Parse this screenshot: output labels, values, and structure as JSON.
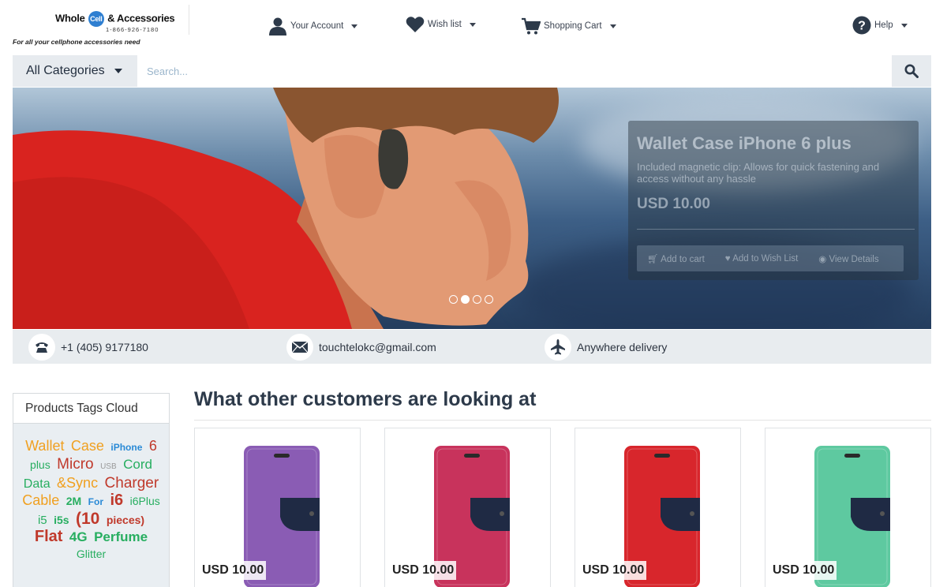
{
  "logo": {
    "brand_a": "Whole",
    "brand_circle": "Cell",
    "brand_b": "& Accessories",
    "phone": "1-866-926-7180",
    "tagline": "For all your cellphone accessories need"
  },
  "topnav": {
    "account": "Your Account",
    "wishlist": "Wish list",
    "cart": "Shopping Cart",
    "help": "Help"
  },
  "search": {
    "category": "All Categories",
    "placeholder": "Search..."
  },
  "hero": {
    "title": "Wallet Case iPhone 6 plus",
    "description": "Included magnetic clip: Allows for quick fastening and access without any hassle",
    "price": "USD 10.00",
    "buttons": {
      "add_cart": "Add to cart",
      "add_wish": "Add to Wish List",
      "view": "View Details"
    },
    "active_slide": 2,
    "slide_count": 4
  },
  "contact": {
    "phone": "+1 (405) 9177180",
    "email": "touchtelokc@gmail.com",
    "delivery": "Anywhere delivery"
  },
  "tags": {
    "title": "Products Tags Cloud",
    "items": [
      {
        "text": "Wallet",
        "color": "#f0a020",
        "size": 18
      },
      {
        "text": "Case",
        "color": "#f0a020",
        "size": 18
      },
      {
        "text": "iPhone",
        "color": "#2a8ad6",
        "size": 12,
        "bold": true
      },
      {
        "text": "6",
        "color": "#c0392b",
        "size": 18
      },
      {
        "text": "plus",
        "color": "#27ae60",
        "size": 14
      },
      {
        "text": "Micro",
        "color": "#c0392b",
        "size": 19
      },
      {
        "text": "USB",
        "color": "#999999",
        "size": 10
      },
      {
        "text": "Cord",
        "color": "#27ae60",
        "size": 17
      },
      {
        "text": "Data",
        "color": "#27ae60",
        "size": 16
      },
      {
        "text": "&Sync",
        "color": "#f0a020",
        "size": 18
      },
      {
        "text": "Charger",
        "color": "#c0392b",
        "size": 19
      },
      {
        "text": "Cable",
        "color": "#f0a020",
        "size": 18
      },
      {
        "text": "2M",
        "color": "#27ae60",
        "size": 14,
        "bold": true
      },
      {
        "text": "For",
        "color": "#2a8ad6",
        "size": 12,
        "bold": true
      },
      {
        "text": "i6",
        "color": "#c0392b",
        "size": 20,
        "bold": true
      },
      {
        "text": "i6Plus",
        "color": "#27ae60",
        "size": 14
      },
      {
        "text": "i5",
        "color": "#27ae60",
        "size": 15
      },
      {
        "text": "i5s",
        "color": "#27ae60",
        "size": 14,
        "bold": true
      },
      {
        "text": "(10",
        "color": "#c0392b",
        "size": 21,
        "bold": true
      },
      {
        "text": "pieces)",
        "color": "#c0392b",
        "size": 14,
        "bold": true
      },
      {
        "text": "Flat",
        "color": "#c0392b",
        "size": 20,
        "bold": true
      },
      {
        "text": "4G",
        "color": "#27ae60",
        "size": 17,
        "bold": true
      },
      {
        "text": "Perfume",
        "color": "#27ae60",
        "size": 17,
        "bold": true
      },
      {
        "text": "Glitter",
        "color": "#27ae60",
        "size": 14
      }
    ]
  },
  "products": {
    "title": "What other customers are looking at",
    "items": [
      {
        "price": "USD 10.00",
        "color": "#8a5cb4"
      },
      {
        "price": "USD 10.00",
        "color": "#c8335c"
      },
      {
        "price": "USD 10.00",
        "color": "#d8262c"
      },
      {
        "price": "USD 10.00",
        "color": "#5ec9a0"
      }
    ]
  },
  "colors": {
    "accent": "#2d3a4a",
    "search_bg": "#e7ebef",
    "strip_bg": "#e8ecef"
  }
}
